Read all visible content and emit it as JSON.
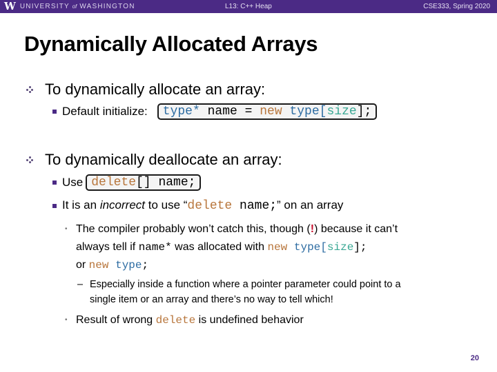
{
  "header": {
    "logo_mark": "W",
    "university_pre": "UNIVERSITY",
    "university_of": "of",
    "university_post": "WASHINGTON",
    "lecture": "L13:  C++ Heap",
    "course": "CSE333, Spring 2020"
  },
  "slide": {
    "title": "Dynamically Allocated Arrays",
    "bullet1": {
      "text": "To dynamically allocate an array:",
      "sub1": {
        "label": "Default initialize:",
        "code": {
          "t1": "type*",
          "t2": " name = ",
          "t3": "new",
          "t4": " ",
          "t5": "type",
          "t6": "[",
          "t7": "size",
          "t8": "];"
        }
      }
    },
    "bullet2": {
      "text": "To dynamically deallocate an array:",
      "sub1": {
        "label": "Use",
        "code": {
          "t1": "delete",
          "t2": "[] name;"
        }
      },
      "sub2": {
        "pre": "It is an ",
        "em": "incorrect",
        "mid": " to use “",
        "code_kw": "delete",
        "code_rest": " name;",
        "post": "” on an array"
      },
      "sub3": {
        "line1_a": "The compiler probably won’t catch this, though (",
        "excl": "!",
        "line1_b": ") because it can’t",
        "line2_a": "always tell if ",
        "line2_code": "name*",
        "line2_b": " was allocated with ",
        "line2_kw": "new",
        "line2_ty": " type",
        "line2_br1": "[",
        "line2_sz": "size",
        "line2_br2": "];",
        "line3_a": "or ",
        "line3_kw": "new",
        "line3_ty": " type",
        "line3_end": ";"
      },
      "sub4": {
        "dash": "–",
        "line1": "Especially inside a function where a pointer parameter could point to a",
        "line2": "single item or an array and there’s no way to tell which!"
      },
      "sub5": {
        "pre": "Result of wrong ",
        "kw": "delete",
        "post": " is undefined behavior"
      }
    },
    "page_number": "20"
  },
  "colors": {
    "brand_purple": "#4b2a85",
    "keyword": "#b8763c",
    "type": "#2d6ca2",
    "param": "#3aa894",
    "alert": "#c8102e"
  }
}
